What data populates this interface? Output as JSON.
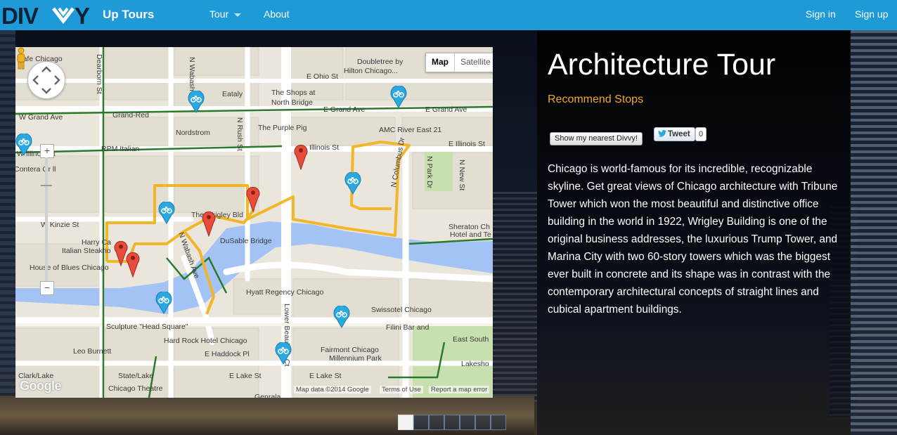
{
  "navbar": {
    "logo_text": "DIVVY",
    "brand": "Up Tours",
    "tour_label": "Tour",
    "about_label": "About",
    "signin_label": "Sign in",
    "signup_label": "Sign up",
    "bar_color": "#1e9ad6"
  },
  "map": {
    "type_buttons": [
      "Map",
      "Satellite"
    ],
    "selected_type": "Map",
    "attribution": "Map data ©2014 Google",
    "terms": "Terms of Use",
    "report": "Report a map error",
    "google_logo": "Google",
    "labels": [
      "Cafe Chicago",
      "Doubletree by",
      "Hilton Chicago...",
      "E Ohio St",
      "Eataly",
      "The Shops at",
      "North Bridge",
      "Grand-Red",
      "W Grand Ave",
      "E Grand Ave",
      "E Grand Ave",
      "Nordstrom",
      "The Purple Pig",
      "AMC River East 21",
      "RPM Italian",
      "W Illinois St",
      "Illinois St",
      "E Illinois St",
      "Contera Gr ll",
      "W Kinzie St",
      "The Wrigley Bld",
      "Harry Ca",
      "Italian Steakho",
      "House of Blues Chicago",
      "DuSable Bridge",
      "Sheraton Ch",
      "Hotel and Te",
      "Hyatt Regency Chicago",
      "Swissotel Chicago",
      "Filini Bar and",
      "Sculpture \"Head Square\"",
      "Hard Rock Hotel Chicago",
      "E Haddock Pl",
      "Leo Burnett",
      "Fairmont Chicago",
      "Millennium Park",
      "E Lake St",
      "East South",
      "Lakesho",
      "Clark/Lake",
      "State/Lake",
      "E Lake St",
      "Chicago Theatre",
      "Dearborn St",
      "N Wabash Av",
      "N Rush St",
      "N Wabash Ave",
      "N Park Dr",
      "N New St",
      "N Columbus Dr",
      "Lower Beaubien Ct",
      "Genrala"
    ]
  },
  "content": {
    "title": "Architecture Tour",
    "recommend": "Recommend Stops",
    "nearest_button": "Show my nearest Divvy!",
    "tweet_button": "Tweet",
    "tweet_count": "0",
    "description": "Chicago is world-famous for its incredible, recognizable skyline. Get great views of Chicago architecture with Tribune Tower which won the most beautiful and distinctive office building in the world in 1922, Wrigley Building is one of the original business addresses, the luxurious Trump Tower, and Marina City with two 60-story towers which was the biggest ever built in concrete and its shape was in contrast with the contemporary architectural concepts of straight lines and cubical apartment buildings.",
    "accent_color": "#f4a81f"
  },
  "carousel": {
    "slide_count": 7,
    "active_index": 0
  },
  "icons": {
    "pan": "pan-control-icon",
    "pegman": "street-view-pegman-icon",
    "bike": "divvy-bike-station-icon",
    "marker": "red-map-marker-icon",
    "twitter": "twitter-bird-icon"
  }
}
